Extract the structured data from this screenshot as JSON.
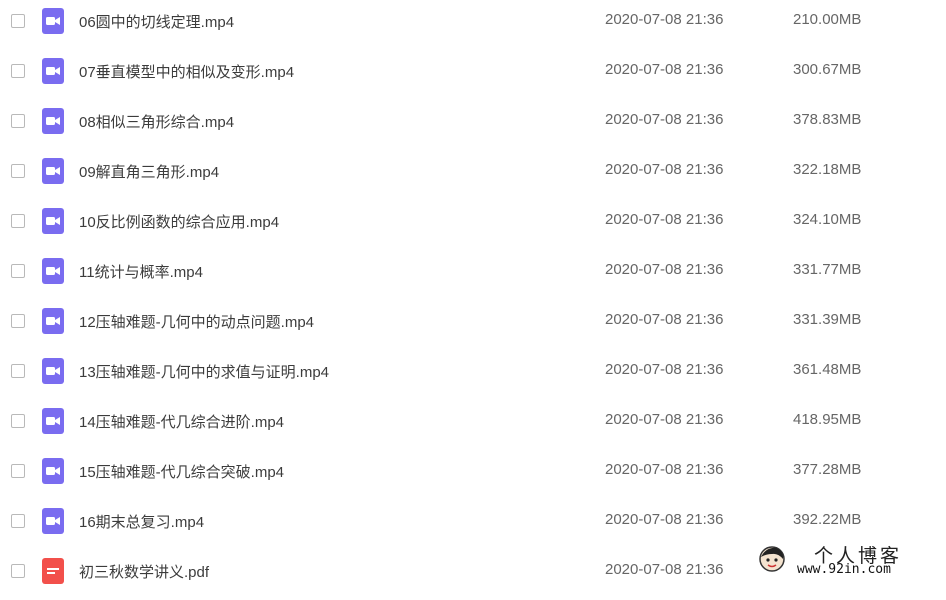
{
  "files": [
    {
      "name": "06圆中的切线定理.mp4",
      "date": "2020-07-08 21:36",
      "size": "210.00MB",
      "type": "video"
    },
    {
      "name": "07垂直模型中的相似及变形.mp4",
      "date": "2020-07-08 21:36",
      "size": "300.67MB",
      "type": "video"
    },
    {
      "name": "08相似三角形综合.mp4",
      "date": "2020-07-08 21:36",
      "size": "378.83MB",
      "type": "video"
    },
    {
      "name": "09解直角三角形.mp4",
      "date": "2020-07-08 21:36",
      "size": "322.18MB",
      "type": "video"
    },
    {
      "name": "10反比例函数的综合应用.mp4",
      "date": "2020-07-08 21:36",
      "size": "324.10MB",
      "type": "video"
    },
    {
      "name": "11统计与概率.mp4",
      "date": "2020-07-08 21:36",
      "size": "331.77MB",
      "type": "video"
    },
    {
      "name": "12压轴难题-几何中的动点问题.mp4",
      "date": "2020-07-08 21:36",
      "size": "331.39MB",
      "type": "video"
    },
    {
      "name": "13压轴难题-几何中的求值与证明.mp4",
      "date": "2020-07-08 21:36",
      "size": "361.48MB",
      "type": "video"
    },
    {
      "name": "14压轴难题-代几综合进阶.mp4",
      "date": "2020-07-08 21:36",
      "size": "418.95MB",
      "type": "video"
    },
    {
      "name": "15压轴难题-代几综合突破.mp4",
      "date": "2020-07-08 21:36",
      "size": "377.28MB",
      "type": "video"
    },
    {
      "name": "16期末总复习.mp4",
      "date": "2020-07-08 21:36",
      "size": "392.22MB",
      "type": "video"
    },
    {
      "name": "初三秋数学讲义.pdf",
      "date": "2020-07-08 21:36",
      "size": "",
      "type": "pdf"
    }
  ],
  "icons": {
    "video": "video-file-icon",
    "pdf": "pdf-file-icon"
  },
  "colors": {
    "video_icon": "#7a6cf0",
    "pdf_icon": "#f2504b"
  },
  "watermark": {
    "title": "个人博客",
    "url": "www.92in.com"
  }
}
